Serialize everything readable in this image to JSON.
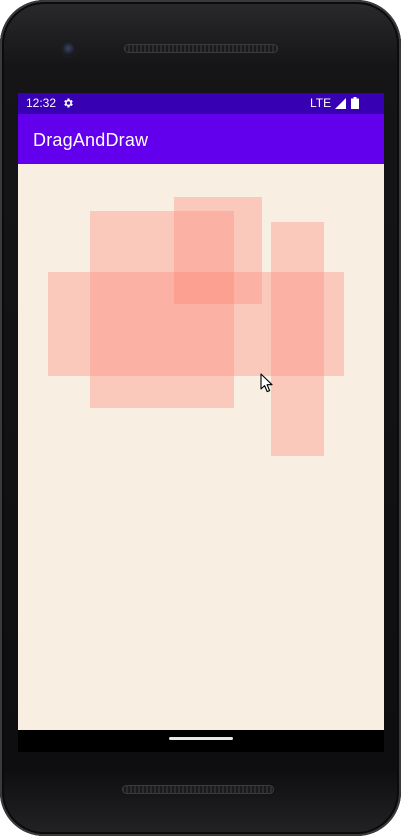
{
  "status_bar": {
    "time": "12:32",
    "network": "LTE",
    "background_color": "#3700b3",
    "icons": [
      "gear-icon",
      "signal-icon",
      "battery-icon"
    ]
  },
  "app_bar": {
    "title": "DragAndDraw",
    "background_color": "#6200ee"
  },
  "canvas": {
    "background_color": "#f8eee1",
    "box_color": "#ff8070",
    "box_count": 4
  },
  "pointer": {
    "icon": "cursor-icon"
  }
}
